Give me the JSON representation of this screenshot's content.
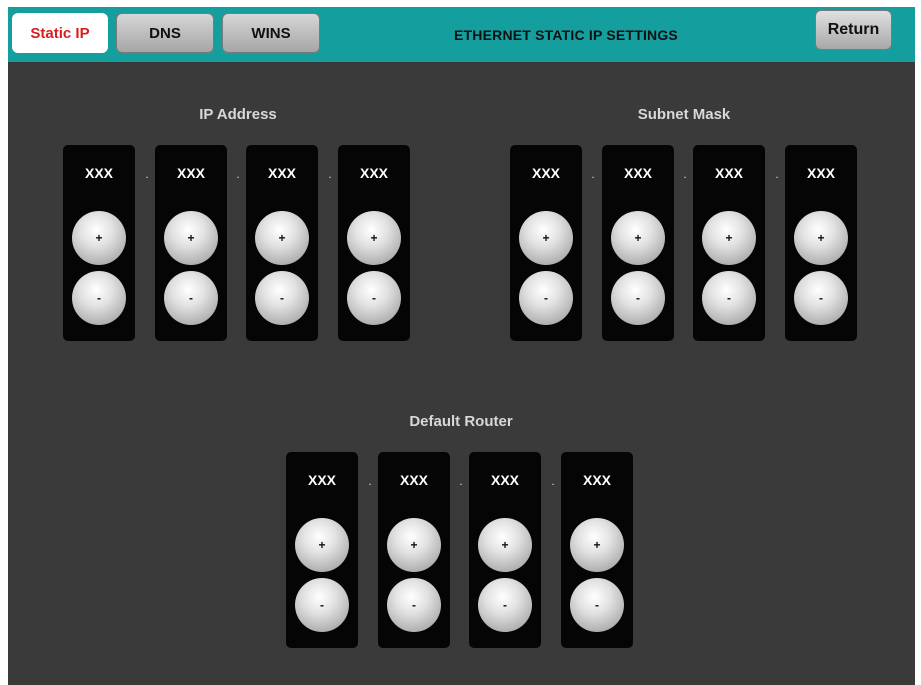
{
  "tabs": [
    {
      "label": "Static IP",
      "active": true
    },
    {
      "label": "DNS",
      "active": false
    },
    {
      "label": "WINS",
      "active": false
    }
  ],
  "header": {
    "title": "ETHERNET STATIC IP SETTINGS",
    "return_label": "Return"
  },
  "glyphs": {
    "plus": "+",
    "minus": "-",
    "separator": "."
  },
  "groups": {
    "ip_address": {
      "label": "IP Address",
      "octets": [
        "XXX",
        "XXX",
        "XXX",
        "XXX"
      ]
    },
    "subnet_mask": {
      "label": "Subnet Mask",
      "octets": [
        "XXX",
        "XXX",
        "XXX",
        "XXX"
      ]
    },
    "default_router": {
      "label": "Default Router",
      "octets": [
        "XXX",
        "XXX",
        "XXX",
        "XXX"
      ]
    }
  },
  "colors": {
    "topbar": "#149e9e",
    "background": "#3a3a3a",
    "active_tab_text": "#d91e1e",
    "octet_panel": "#050505"
  }
}
